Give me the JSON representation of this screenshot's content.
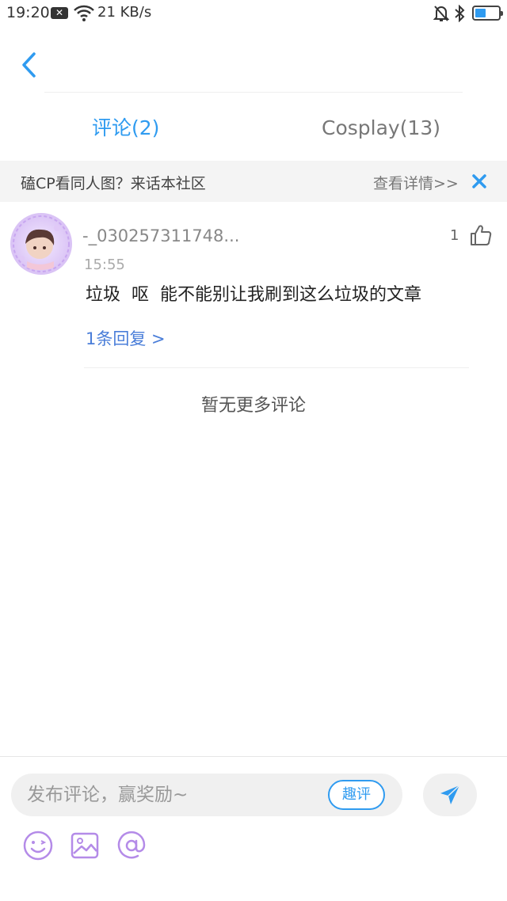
{
  "status_bar": {
    "time": "19:20",
    "notification_icon": "x-box-icon",
    "speed": "21 KB/s",
    "battery_level": 0.45,
    "icons": [
      "wifi-icon",
      "bell-muted-icon",
      "bluetooth-icon",
      "battery-icon"
    ]
  },
  "header": {
    "back_icon": "chevron-left-icon"
  },
  "tabs": [
    {
      "label": "评论(2)",
      "active": true
    },
    {
      "label": "Cosplay(13)",
      "active": false
    }
  ],
  "banner": {
    "text": "磕CP看同人图？来话本社区",
    "link": "查看详情>>",
    "close_icon": "close-icon"
  },
  "comments": [
    {
      "username": "-_030257311748...",
      "time": "15:55",
      "text": "垃圾  呕  能不能别让我刷到这么垃圾的文章",
      "likes": "1",
      "replies": "1条回复 >"
    }
  ],
  "no_more": "暂无更多评论",
  "composer": {
    "placeholder": "发布评论，赢奖励~",
    "quping_label": "趣评",
    "send_icon": "send-icon",
    "tools": [
      "emoji-icon",
      "image-icon",
      "at-icon"
    ]
  },
  "colors": {
    "accent": "#2f9bf0",
    "link": "#4a7ed9",
    "tool": "#b48be8"
  }
}
